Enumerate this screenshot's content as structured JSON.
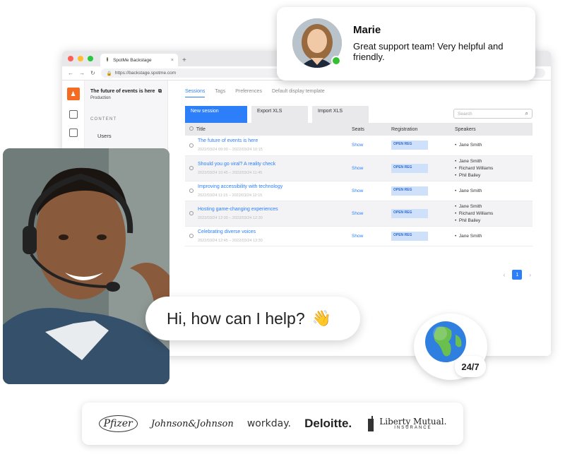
{
  "browser": {
    "tab_title": "SpotMe Backstage",
    "tab_close": "×",
    "new_tab": "+",
    "url": "https://backstage.spotme.com"
  },
  "sidebar": {
    "event_title": "The future of events is here",
    "event_sub": "Production",
    "section": "CONTENT",
    "item": "Users"
  },
  "tabs": [
    "Sessions",
    "Tags",
    "Preferences",
    "Default display template"
  ],
  "toolbar": {
    "new_session": "New session",
    "export": "Export XLS",
    "import": "Import XLS",
    "search_placeholder": "Search"
  },
  "table": {
    "headers": [
      "Title",
      "Seats",
      "Registration",
      "Speakers"
    ],
    "rows": [
      {
        "title": "The future of events is here",
        "date": "2022/03/24 09:00 – 2022/03/24 10:15",
        "seats": "Show",
        "reg": "OPEN REG",
        "speakers": [
          "Jane Smith"
        ]
      },
      {
        "title": "Should you go viral? A reality check",
        "date": "2022/03/24 10:45 – 2022/03/24 11:45",
        "seats": "Show",
        "reg": "OPEN REG",
        "speakers": [
          "Jane Smith",
          "Richard Williams",
          "Phil Bailey"
        ]
      },
      {
        "title": "Improving accessibility with technology",
        "date": "2022/03/24 11:15 – 2022/03/24 12:15",
        "seats": "Show",
        "reg": "OPEN REG",
        "speakers": [
          "Jane Smith"
        ]
      },
      {
        "title": "Hosting game-changing experiences",
        "date": "2022/03/24 12:00 – 2022/03/24 12:30",
        "seats": "Show",
        "reg": "OPEN REG",
        "speakers": [
          "Jane Smith",
          "Richard Williams",
          "Phil Bailey"
        ]
      },
      {
        "title": "Celebrating diverse voices",
        "date": "2022/03/24 12:45 – 2022/03/24 13:30",
        "seats": "Show",
        "reg": "OPEN REG",
        "speakers": [
          "Jane Smith"
        ]
      }
    ]
  },
  "pager": {
    "prev": "‹",
    "page": "1",
    "next": "›"
  },
  "review": {
    "name": "Marie",
    "text": "Great support team! Very helpful and friendly."
  },
  "help": {
    "text": "Hi, how can I help?",
    "emoji": "👋"
  },
  "availability": "24/7",
  "logos": {
    "pfizer": "Pfizer",
    "jj": "Johnson&Johnson",
    "workday": "workday.",
    "deloitte": "Deloitte.",
    "liberty_top": "Liberty Mutual.",
    "liberty_sub": "INSURANCE"
  },
  "colors": {
    "accent": "#2d7ff9",
    "brand_orange": "#f36c21",
    "online": "#35c032"
  }
}
